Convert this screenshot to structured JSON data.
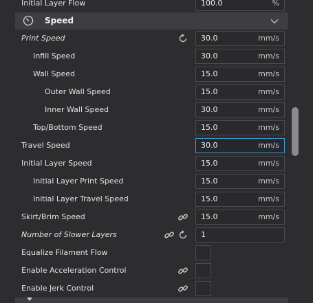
{
  "top_row": {
    "label": "Initial Layer Flow",
    "value": "100.0",
    "unit": "%"
  },
  "section": {
    "title": "Speed",
    "icon": "speedometer-icon",
    "toggle_icon": "chevron-down-icon"
  },
  "settings": [
    {
      "label": "Print Speed",
      "value": "30.0",
      "unit": "mm/s"
    },
    {
      "label": "Infill Speed",
      "value": "30.0",
      "unit": "mm/s"
    },
    {
      "label": "Wall Speed",
      "value": "15.0",
      "unit": "mm/s"
    },
    {
      "label": "Outer Wall Speed",
      "value": "15.0",
      "unit": "mm/s"
    },
    {
      "label": "Inner Wall Speed",
      "value": "30.0",
      "unit": "mm/s"
    },
    {
      "label": "Top/Bottom Speed",
      "value": "15.0",
      "unit": "mm/s"
    },
    {
      "label": "Travel Speed",
      "value": "30.0",
      "unit": "mm/s"
    },
    {
      "label": "Initial Layer Speed",
      "value": "15.0",
      "unit": "mm/s"
    },
    {
      "label": "Initial Layer Print Speed",
      "value": "15.0",
      "unit": "mm/s"
    },
    {
      "label": "Initial Layer Travel Speed",
      "value": "15.0",
      "unit": "mm/s"
    },
    {
      "label": "Skirt/Brim Speed",
      "value": "15.0",
      "unit": "mm/s"
    },
    {
      "label": "Number of Slower Layers",
      "value": "1",
      "unit": ""
    },
    {
      "label": "Equalize Filament Flow",
      "value": "",
      "unit": ""
    },
    {
      "label": "Enable Acceleration Control",
      "value": "",
      "unit": ""
    },
    {
      "label": "Enable Jerk Control",
      "value": "",
      "unit": ""
    }
  ]
}
